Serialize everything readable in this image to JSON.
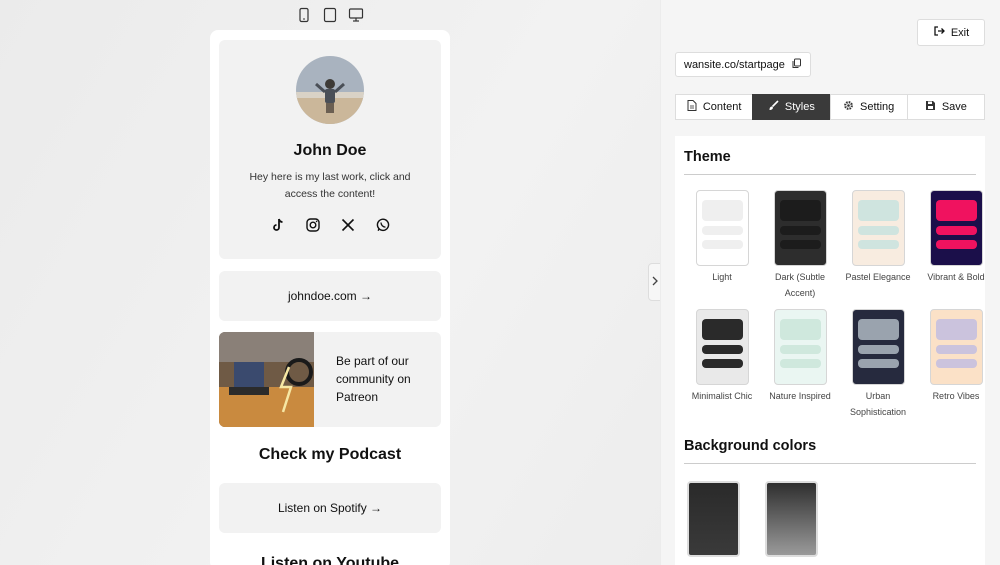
{
  "preview": {
    "profile": {
      "name": "John Doe",
      "bio": "Hey here is my last work, click and access the content!"
    },
    "socials": [
      "tiktok-icon",
      "instagram-icon",
      "x-icon",
      "whatsapp-icon"
    ],
    "link1": "johndoe.com →",
    "patreon_text": "Be part of our community on Patreon",
    "podcast_title": "Check my Podcast",
    "spotify_link": "Listen on Spotify →",
    "youtube_title": "Listen on Youtube"
  },
  "panel": {
    "exit_label": "Exit",
    "url": "wansite.co/startpage",
    "tabs": [
      {
        "label": "Content",
        "icon": "document-icon"
      },
      {
        "label": "Styles",
        "icon": "brush-icon"
      },
      {
        "label": "Setting",
        "icon": "gear-icon"
      },
      {
        "label": "Save",
        "icon": "save-icon"
      }
    ],
    "active_tab": "Styles",
    "theme_heading": "Theme",
    "themes": [
      {
        "label": "Light",
        "bg": "#ffffff",
        "c1": "#efefef",
        "c2": "#efefef"
      },
      {
        "label": "Dark (Subtle Accent)",
        "bg": "#2d2d2d",
        "c1": "#1c1c1c",
        "c2": "#1c1c1c"
      },
      {
        "label": "Pastel Elegance",
        "bg": "#f8ece0",
        "c1": "#cfe4df",
        "c2": "#cfe4df"
      },
      {
        "label": "Vibrant & Bold",
        "bg": "#1b0f4a",
        "c1": "#f0125f",
        "c2": "#f0125f"
      },
      {
        "label": "Minimalist Chic",
        "bg": "#e9e9e9",
        "c1": "#2a2a2a",
        "c2": "#2a2a2a"
      },
      {
        "label": "Nature Inspired",
        "bg": "#eaf6f2",
        "c1": "#cfe8dd",
        "c2": "#cfe8dd"
      },
      {
        "label": "Urban Sophistication",
        "bg": "#262a3e",
        "c1": "#9aa3ae",
        "c2": "#9aa3ae"
      },
      {
        "label": "Retro Vibes",
        "bg": "#fbe1c7",
        "c1": "#cbc3dd",
        "c2": "#cbc3dd"
      }
    ],
    "background_heading": "Background colors",
    "background_swatches": [
      {
        "name": "dark-texture",
        "from": "#2a2a2a",
        "to": "#3a3a3a"
      },
      {
        "name": "gray-gradient",
        "from": "#2f2f2f",
        "to": "#9a9a9a"
      }
    ]
  }
}
